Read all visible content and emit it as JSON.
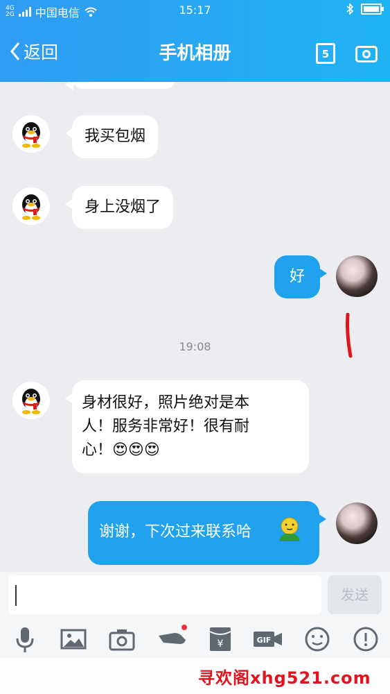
{
  "status_bar": {
    "network_top": "4G",
    "network_bottom": "2G",
    "carrier": "中国电信",
    "time": "15:17"
  },
  "header": {
    "back_label": "返回",
    "title": "手机相册",
    "calendar_digit": "5"
  },
  "messages": [
    {
      "side": "left",
      "text": "我买包烟"
    },
    {
      "side": "left",
      "text": "身上没烟了"
    },
    {
      "side": "right",
      "text": "好"
    },
    {
      "side": "left",
      "text_lines": [
        "身材很好，照片绝对是本",
        "人！服务非常好！很有耐",
        "心！😍😍😍"
      ]
    },
    {
      "side": "right",
      "text": "谢谢，下次过来联系哈"
    }
  ],
  "timestamp": "19:08",
  "input": {
    "value": "",
    "send_label": "发送"
  },
  "toolbar": {
    "items": [
      "microphone-icon",
      "image-icon",
      "camera-icon",
      "hongbao-icon",
      "red-packet-icon",
      "gif-icon",
      "emoji-icon",
      "more-icon"
    ],
    "gif_label": "GIF",
    "yen_label": "¥"
  },
  "watermark": "寻欢阁xhg521.com",
  "colors": {
    "header_blue": "#2f9cf2",
    "bubble_blue": "#21a2ee",
    "chat_background": "#ecedf1",
    "watermark_red": "#e0141e"
  }
}
